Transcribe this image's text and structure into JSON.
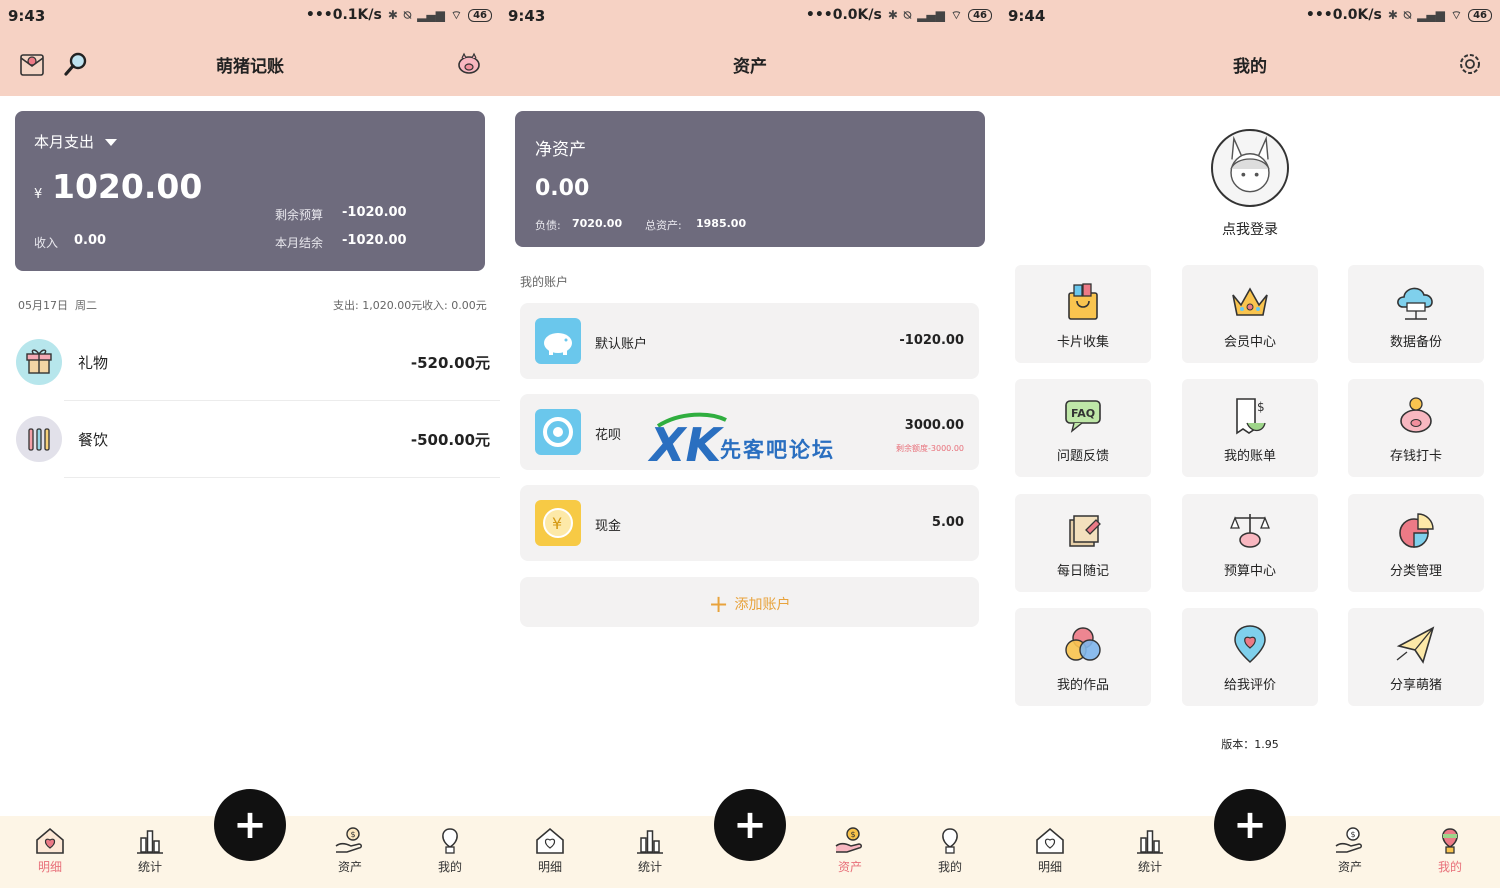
{
  "panels": [
    {
      "status": {
        "time": "9:43",
        "speed": "0.1K/s",
        "battery": "46"
      },
      "title": "萌猪记账",
      "summary": {
        "period": "本月支出",
        "currency": "¥",
        "amount": "1020.00",
        "budget_label": "剩余预算",
        "budget_value": "-1020.00",
        "income_label": "收入",
        "income_value": "0.00",
        "balance_label": "本月结余",
        "balance_value": "-1020.00"
      },
      "day": {
        "date": "05月17日",
        "weekday": "周二",
        "expense": "支出: 1,020.00元",
        "income": "收入: 0.00元"
      },
      "records": [
        {
          "name": "礼物",
          "amount": "-520.00元",
          "icon": "gift-icon",
          "color": "#b7e6ec"
        },
        {
          "name": "餐饮",
          "amount": "-500.00元",
          "icon": "cutlery-icon",
          "color": "#e2e1ea"
        }
      ]
    },
    {
      "status": {
        "time": "9:43",
        "speed": "0.0K/s",
        "battery": "46"
      },
      "title": "资产",
      "net": {
        "label": "净资产",
        "value": "0.00",
        "debt_label": "负债:",
        "debt_value": "7020.00",
        "assets_label": "总资产:",
        "assets_value": "1985.00"
      },
      "accounts_header": "我的账户",
      "accounts": [
        {
          "name": "默认账户",
          "amount": "-1020.00",
          "sub": "",
          "icon": "piggy-icon",
          "color": "#6ac7ec"
        },
        {
          "name": "花呗",
          "amount": "3000.00",
          "sub": "剩余额度-3000.00",
          "icon": "huabei-icon",
          "color": "#6ac7ec"
        },
        {
          "name": "现金",
          "amount": "5.00",
          "sub": "",
          "icon": "yuan-coin-icon",
          "color": "#f7ca45"
        }
      ],
      "add_account": "添加账户"
    },
    {
      "status": {
        "time": "9:44",
        "speed": "0.0K/s",
        "battery": "46"
      },
      "title": "我的",
      "login": "点我登录",
      "tiles": [
        "卡片收集",
        "会员中心",
        "数据备份",
        "问题反馈",
        "我的账单",
        "存钱打卡",
        "每日随记",
        "预算中心",
        "分类管理",
        "我的作品",
        "给我评价",
        "分享萌猪"
      ],
      "version": "版本：1.95"
    }
  ],
  "nav": [
    "明细",
    "统计",
    "资产",
    "我的"
  ],
  "watermark": {
    "logo": "XK",
    "text": "先客吧论坛"
  },
  "colors": {
    "accent": "#e8707a",
    "header": "#f6d2c4",
    "card": "#6e6b7d",
    "add": "#e8a33c"
  }
}
